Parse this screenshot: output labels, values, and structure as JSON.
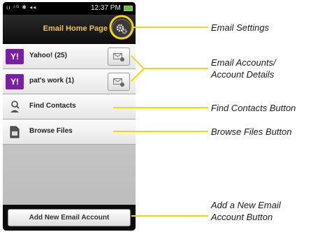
{
  "status_bar": {
    "time": "12:37 PM",
    "left_icons": "ıı ⁴ᴳ ✱ ◂◂"
  },
  "header": {
    "title": "Email Home Page"
  },
  "accounts": [
    {
      "logo": "Y!",
      "label": "Yahoo! (25)"
    },
    {
      "logo": "Y!",
      "label": "pat's work (1)"
    }
  ],
  "actions": {
    "find_contacts": "Find Contacts",
    "browse_files": "Browse Files",
    "add_account": "Add New Email Account"
  },
  "callouts": {
    "email_settings": "Email Settings",
    "accounts_line1": "Email Accounts/",
    "accounts_line2": "Account Details",
    "find_contacts": "Find Contacts Button",
    "browse_files": "Browse Files Button",
    "add_line1": "Add a New Email",
    "add_line2": "Account Button"
  },
  "colors": {
    "title_accent": "#f3c44a",
    "callout_line": "#f5d60a",
    "yahoo_purple": "#7b1fa2",
    "battery_green": "#6cc04a"
  },
  "icons": {
    "settings": "gear-icon",
    "account_detail": "envelope-gear-icon",
    "find_contacts": "person-search-icon",
    "browse_files": "file-icon"
  }
}
